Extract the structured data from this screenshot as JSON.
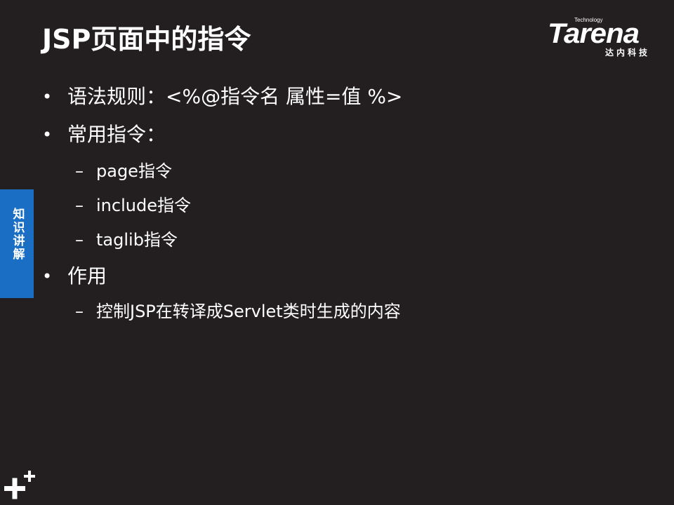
{
  "slide": {
    "title": "JSP页面中的指令"
  },
  "logo": {
    "technology": "Technology",
    "wordmark": "Tarena",
    "chinese": "达内科技"
  },
  "side_tab": {
    "label": "知识讲解",
    "color": "#1a6fc4"
  },
  "bullets": [
    {
      "text": "语法规则：<%@指令名  属性=值  %>"
    },
    {
      "text": "常用指令："
    },
    {
      "text": "作用"
    }
  ],
  "sub_items": [
    {
      "text": "page指令"
    },
    {
      "text": "include指令"
    },
    {
      "text": "taglib指令"
    },
    {
      "text": "控制JSP在转译成Servlet类时生成的内容"
    }
  ],
  "markers": {
    "bullet": "•",
    "dash": "–"
  },
  "colors": {
    "background": "#231f20",
    "text": "#ffffff"
  },
  "icons": {
    "corner": "plus-icon"
  }
}
